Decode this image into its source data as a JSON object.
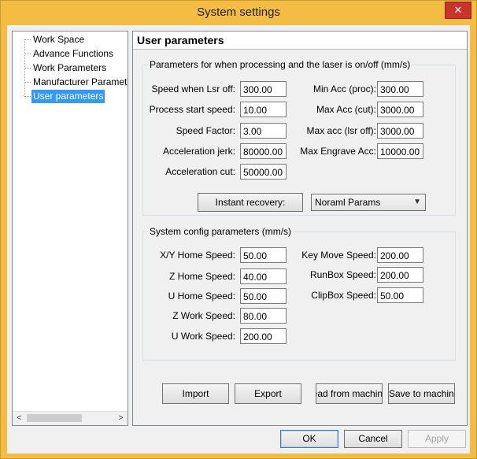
{
  "window": {
    "title": "System settings",
    "close_glyph": "✕"
  },
  "tree": {
    "items": [
      {
        "label": "Work Space"
      },
      {
        "label": "Advance Functions"
      },
      {
        "label": "Work Parameters"
      },
      {
        "label": "Manufacturer Paramet"
      },
      {
        "label": "User parameters",
        "selected": true
      }
    ],
    "scroll_left_glyph": "<",
    "scroll_right_glyph": ">"
  },
  "panel": {
    "title": "User parameters",
    "laser_group": {
      "label": "Parameters for when processing and the laser is on/off (mm/s)",
      "left_fields": [
        {
          "label": "Speed when Lsr off:",
          "value": "300.00"
        },
        {
          "label": "Process start speed:",
          "value": "10.00"
        },
        {
          "label": "Speed Factor:",
          "value": "3.00"
        },
        {
          "label": "Acceleration jerk:",
          "value": "80000.00"
        },
        {
          "label": "Acceleration cut:",
          "value": "50000.00"
        }
      ],
      "right_fields": [
        {
          "label": "Min Acc (proc):",
          "value": "300.00"
        },
        {
          "label": "Max Acc (cut):",
          "value": "3000.00"
        },
        {
          "label": "Max acc (lsr off):",
          "value": "3000.00"
        },
        {
          "label": "Max Engrave Acc:",
          "value": "10000.00"
        }
      ],
      "instant_recovery_label": "Instant recovery:",
      "params_select_value": "Noraml Params"
    },
    "system_group": {
      "label": "System config parameters (mm/s)",
      "left_fields": [
        {
          "label": "X/Y Home Speed:",
          "value": "50.00"
        },
        {
          "label": "Z Home Speed:",
          "value": "40.00"
        },
        {
          "label": "U Home Speed:",
          "value": "50.00"
        },
        {
          "label": "Z Work Speed:",
          "value": "80.00"
        },
        {
          "label": "U Work Speed:",
          "value": "200.00"
        }
      ],
      "right_fields": [
        {
          "label": "Key Move Speed:",
          "value": "200.00"
        },
        {
          "label": "RunBox Speed:",
          "value": "200.00"
        },
        {
          "label": "ClipBox Speed:",
          "value": "50.00"
        }
      ]
    },
    "actions": {
      "import_label": "Import",
      "export_label": "Export",
      "read_label": "Read from machine",
      "save_label": "Save to machine"
    }
  },
  "footer": {
    "ok_label": "OK",
    "cancel_label": "Cancel",
    "apply_label": "Apply"
  }
}
